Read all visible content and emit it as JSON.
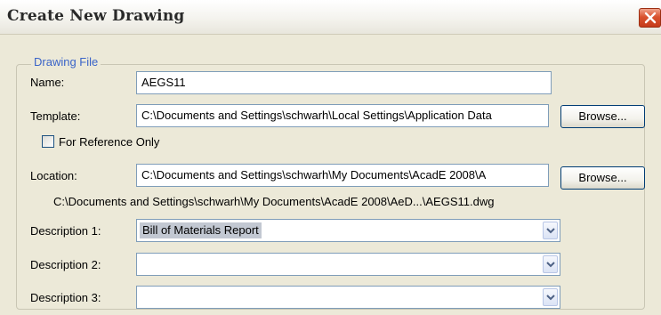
{
  "window": {
    "title": "Create New Drawing"
  },
  "drawing_file": {
    "legend": "Drawing File",
    "name_label": "Name:",
    "name_value": "AEGS11",
    "template_label": "Template:",
    "template_value": "C:\\Documents and Settings\\schwarh\\Local Settings\\Application Data",
    "template_browse": "Browse...",
    "reference_label": "For Reference Only",
    "reference_checked": false,
    "location_label": "Location:",
    "location_value": "C:\\Documents and Settings\\schwarh\\My Documents\\AcadE 2008\\A",
    "location_browse": "Browse...",
    "full_path": "C:\\Documents and Settings\\schwarh\\My Documents\\AcadE 2008\\AeD...\\AEGS11.dwg"
  },
  "descriptions": [
    {
      "label": "Description 1:",
      "value": "Bill of Materials Report"
    },
    {
      "label": "Description 2:",
      "value": ""
    },
    {
      "label": "Description 3:",
      "value": ""
    }
  ],
  "icons": {
    "close": "close-icon",
    "dropdown": "chevron-down-icon"
  },
  "colors": {
    "legend_text": "#3a64c8",
    "close_button": "#d9532f",
    "field_border": "#7f9db9",
    "selection_highlight": "#c2c8d2"
  }
}
